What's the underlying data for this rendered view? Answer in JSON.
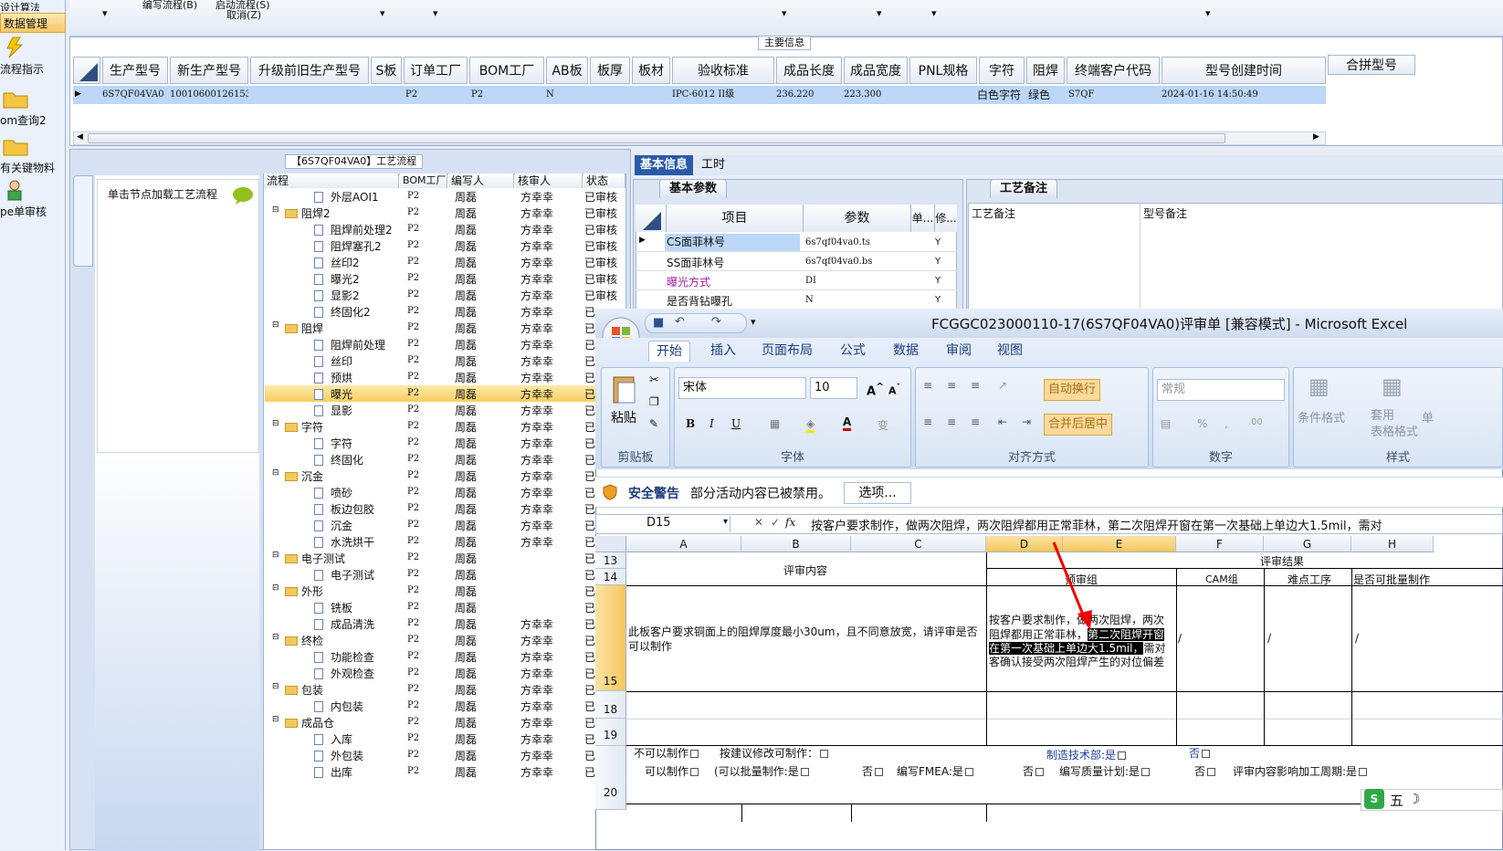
{
  "left_panel": {
    "top_text": "设计算法",
    "selected": "数据管理",
    "items": [
      {
        "label": "流程指示",
        "icon": "lightning-icon"
      },
      {
        "label": "om查询2",
        "icon": "folder-icon"
      },
      {
        "label": "有关键物料",
        "icon": "folder-icon"
      },
      {
        "label": "pe单审核",
        "icon": "user-icon"
      }
    ]
  },
  "menubar": {
    "text1": "编写流程(B)",
    "text2": "启动流程(S)",
    "text3": "取消(Z)"
  },
  "main": {
    "section_title": "主要信息",
    "columns": [
      "生产型号",
      "新生产型号",
      "升级前旧生产型号",
      "S板",
      "订单工厂",
      "BOM工厂",
      "AB板",
      "板厚",
      "板材",
      "验收标准",
      "成品长度",
      "成品宽度",
      "PNL规格",
      "字符",
      "阻焊",
      "终端客户代码",
      "型号创建时间"
    ],
    "right_column": "合拼型号",
    "row": {
      "生产型号": "6S7QF04VA0",
      "新生产型号": "10010600126153",
      "订单工厂": "P2",
      "BOM工厂": "P2",
      "AB板": "N",
      "验收标准": "IPC-6012 II级",
      "成品长度": "236.220",
      "成品宽度": "223.300",
      "字符": "白色字符",
      "阻焊": "绿色",
      "终端客户代码": "S7QF",
      "型号创建时间": "2024-01-16 14:50:49"
    }
  },
  "flow": {
    "title": "【6S7QF04VA0】工艺流程",
    "side_label": "单击节点加载工艺流程",
    "tree_headers": [
      "流程",
      "BOM工厂",
      "编写人",
      "核审人",
      "状态"
    ],
    "rows": [
      {
        "name": "外层AOI1",
        "type": "doc",
        "bom": "P2",
        "writer": "周磊",
        "reviewer": "方幸幸",
        "status": "已审核"
      },
      {
        "name": "阻焊2",
        "type": "folder",
        "bom": "P2",
        "writer": "周磊",
        "reviewer": "方幸幸",
        "status": "已审核"
      },
      {
        "name": "阻焊前处理2",
        "type": "doc",
        "bom": "P2",
        "writer": "周磊",
        "reviewer": "方幸幸",
        "status": "已审核"
      },
      {
        "name": "阻焊塞孔2",
        "type": "doc",
        "bom": "P2",
        "writer": "周磊",
        "reviewer": "方幸幸",
        "status": "已审核"
      },
      {
        "name": "丝印2",
        "type": "doc",
        "bom": "P2",
        "writer": "周磊",
        "reviewer": "方幸幸",
        "status": "已审核"
      },
      {
        "name": "曝光2",
        "type": "doc",
        "bom": "P2",
        "writer": "周磊",
        "reviewer": "方幸幸",
        "status": "已审核"
      },
      {
        "name": "显影2",
        "type": "doc",
        "bom": "P2",
        "writer": "周磊",
        "reviewer": "方幸幸",
        "status": "已审核"
      },
      {
        "name": "终固化2",
        "type": "doc",
        "bom": "P2",
        "writer": "周磊",
        "reviewer": "方幸幸",
        "status": "已"
      },
      {
        "name": "阻焊",
        "type": "folder",
        "bom": "P2",
        "writer": "周磊",
        "reviewer": "方幸幸",
        "status": "已"
      },
      {
        "name": "阻焊前处理",
        "type": "doc",
        "bom": "P2",
        "writer": "周磊",
        "reviewer": "方幸幸",
        "status": "已"
      },
      {
        "name": "丝印",
        "type": "doc",
        "bom": "P2",
        "writer": "周磊",
        "reviewer": "方幸幸",
        "status": "已"
      },
      {
        "name": "预烘",
        "type": "doc",
        "bom": "P2",
        "writer": "周磊",
        "reviewer": "方幸幸",
        "status": "已"
      },
      {
        "name": "曝光",
        "type": "doc",
        "bom": "P2",
        "writer": "周磊",
        "reviewer": "方幸幸",
        "status": "已"
      },
      {
        "name": "显影",
        "type": "doc",
        "bom": "P2",
        "writer": "周磊",
        "reviewer": "方幸幸",
        "status": "已"
      },
      {
        "name": "字符",
        "type": "folder",
        "bom": "P2",
        "writer": "周磊",
        "reviewer": "方幸幸",
        "status": "已"
      },
      {
        "name": "字符",
        "type": "doc",
        "bom": "P2",
        "writer": "周磊",
        "reviewer": "方幸幸",
        "status": "已"
      },
      {
        "name": "终固化",
        "type": "doc",
        "bom": "P2",
        "writer": "周磊",
        "reviewer": "方幸幸",
        "status": "已"
      },
      {
        "name": "沉金",
        "type": "folder",
        "bom": "P2",
        "writer": "周磊",
        "reviewer": "方幸幸",
        "status": "已"
      },
      {
        "name": "喷砂",
        "type": "doc",
        "bom": "P2",
        "writer": "周磊",
        "reviewer": "方幸幸",
        "status": "已"
      },
      {
        "name": "板边包胶",
        "type": "doc",
        "bom": "P2",
        "writer": "周磊",
        "reviewer": "方幸幸",
        "status": "已"
      },
      {
        "name": "沉金",
        "type": "doc",
        "bom": "P2",
        "writer": "周磊",
        "reviewer": "方幸幸",
        "status": "已"
      },
      {
        "name": "水洗烘干",
        "type": "doc",
        "bom": "P2",
        "writer": "周磊",
        "reviewer": "方幸幸",
        "status": "已"
      },
      {
        "name": "电子测试",
        "type": "folder",
        "bom": "P2",
        "writer": "周磊",
        "reviewer": "",
        "status": "已"
      },
      {
        "name": "电子测试",
        "type": "doc",
        "bom": "P2",
        "writer": "周磊",
        "reviewer": "",
        "status": "已"
      },
      {
        "name": "外形",
        "type": "folder",
        "bom": "P2",
        "writer": "周磊",
        "reviewer": "",
        "status": "已"
      },
      {
        "name": "铣板",
        "type": "doc",
        "bom": "P2",
        "writer": "周磊",
        "reviewer": "",
        "status": "已"
      },
      {
        "name": "成品清洗",
        "type": "doc",
        "bom": "P2",
        "writer": "周磊",
        "reviewer": "方幸幸",
        "status": "已"
      },
      {
        "name": "终检",
        "type": "folder",
        "bom": "P2",
        "writer": "周磊",
        "reviewer": "方幸幸",
        "status": "已"
      },
      {
        "name": "功能检查",
        "type": "doc",
        "bom": "P2",
        "writer": "周磊",
        "reviewer": "方幸幸",
        "status": "已"
      },
      {
        "name": "外观检查",
        "type": "doc",
        "bom": "P2",
        "writer": "周磊",
        "reviewer": "方幸幸",
        "status": "已"
      },
      {
        "name": "包装",
        "type": "folder",
        "bom": "P2",
        "writer": "周磊",
        "reviewer": "方幸幸",
        "status": "已"
      },
      {
        "name": "内包装",
        "type": "doc",
        "bom": "P2",
        "writer": "周磊",
        "reviewer": "方幸幸",
        "status": "已"
      },
      {
        "name": "成品仓",
        "type": "folder",
        "bom": "P2",
        "writer": "周磊",
        "reviewer": "方幸幸",
        "status": "已"
      },
      {
        "name": "入库",
        "type": "doc",
        "bom": "P2",
        "writer": "周磊",
        "reviewer": "方幸幸",
        "status": "已"
      },
      {
        "name": "外包装",
        "type": "doc",
        "bom": "P2",
        "writer": "周磊",
        "reviewer": "方幸幸",
        "status": "已"
      },
      {
        "name": "出库",
        "type": "doc",
        "bom": "P2",
        "writer": "周磊",
        "reviewer": "方幸幸",
        "status": "已"
      }
    ]
  },
  "info": {
    "tabs": [
      "基本信息",
      "工时"
    ],
    "params_title": "基本参数",
    "notes_title": "工艺备注",
    "param_headers": [
      "项目",
      "参数",
      "单...",
      "修..."
    ],
    "params": [
      {
        "item": "CS面菲林号",
        "value": "6s7qf04va0.ts",
        "flag": "Y"
      },
      {
        "item": "SS面菲林号",
        "value": "6s7qf04va0.bs",
        "flag": "Y"
      },
      {
        "item": "曝光方式",
        "value": "DI",
        "flag": "Y"
      },
      {
        "item": "是否背钻曝孔",
        "value": "N",
        "flag": "Y"
      }
    ],
    "notes_headers": [
      "工艺备注",
      "型号备注"
    ]
  },
  "excel": {
    "title": "FCGGC023000110-17(6S7QF04VA0)评审单  [兼容模式] - Microsoft Excel",
    "ribbon_tabs": [
      "开始",
      "插入",
      "页面布局",
      "公式",
      "数据",
      "审阅",
      "视图"
    ],
    "font_name": "宋体",
    "font_size": "10",
    "number_format": "常规",
    "group_labels": [
      "剪贴板",
      "字体",
      "对齐方式",
      "数字",
      "样式"
    ],
    "paste_label": "粘贴",
    "wrap_label": "自动换行",
    "merge_label": "合并后居中",
    "cond_format": "条件格式",
    "table_format": "套用\n表格格式",
    "cell_style": "单",
    "security_title": "安全警告",
    "security_text": "部分活动内容已被禁用。",
    "options_button": "选项...",
    "cell_ref": "D15",
    "formula": "按客户要求制作，做两次阻焊，两次阻焊都用正常菲林，第二次阻焊开窗在第一次基础上单边大1.5mil，需对",
    "columns": [
      "A",
      "B",
      "C",
      "D",
      "E",
      "F",
      "G",
      "H"
    ],
    "rows": [
      "13",
      "14",
      "15",
      "18",
      "19",
      "20"
    ],
    "review_content": "评审内容",
    "review_result": "评审结果",
    "prep_group": "预审组",
    "cam_group": "CAM组",
    "difficult": "难点工序",
    "batch": "是否可批量制作",
    "a15": "此板客户要求铜面上的阻焊厚度最小30um，且不同意放宽，请评审是否可以制作",
    "d15_line1": "按客户要求制作，做两次阻焊，两次",
    "d15_line2": "阻焊都用正常菲林，",
    "d15_hl2": "第二次阻焊开窗",
    "d15_hl3": "在第一次基础上单边大1.5mil，",
    "d15_line3b": "需对",
    "d15_line4": "客确认接受两次阻焊产生的对位偏差",
    "slash": "/",
    "r19a": "不可以制作",
    "r19b": "按建议修改可制作：",
    "r19c": "制造技术部:是",
    "r19d": "否",
    "r20a": "可以制作",
    "r20b": "(可以批量制作:是",
    "r20c": "否",
    "r20d": "编写FMEA:是",
    "r20e": "否",
    "r20f": "编写质量计划:是",
    "r20g": "否",
    "r20h": "评审内容影响加工周期:是",
    "ime": "五"
  }
}
